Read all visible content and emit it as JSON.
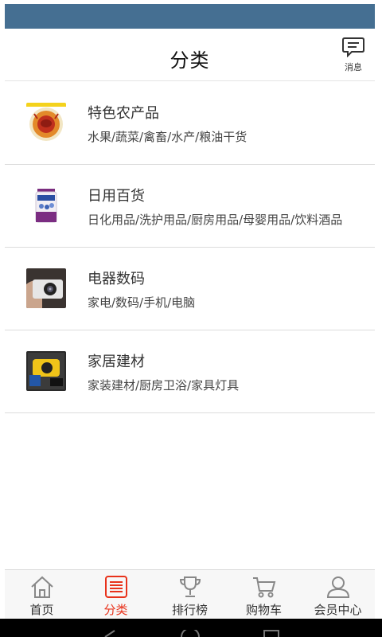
{
  "header": {
    "title": "分类",
    "messages_label": "消息"
  },
  "categories": [
    {
      "title": "特色农产品",
      "subtitle": "水果/蔬菜/禽畜/水产/粮油干货",
      "icon": "crab-dish-thumbnail"
    },
    {
      "title": "日用百货",
      "subtitle": "日化用品/洗护用品/厨房用品/母婴用品/饮料酒品",
      "icon": "milk-powder-thumbnail"
    },
    {
      "title": "电器数码",
      "subtitle": "家电/数码/手机/电脑",
      "icon": "action-camera-thumbnail"
    },
    {
      "title": "家居建材",
      "subtitle": "家装建材/厨房卫浴/家具灯具",
      "icon": "power-tool-thumbnail"
    }
  ],
  "tabs": [
    {
      "label": "首页",
      "icon": "home-icon"
    },
    {
      "label": "分类",
      "icon": "list-icon",
      "active": true
    },
    {
      "label": "排行榜",
      "icon": "trophy-icon"
    },
    {
      "label": "购物车",
      "icon": "cart-icon"
    },
    {
      "label": "会员中心",
      "icon": "user-icon"
    }
  ],
  "colors": {
    "status_bar": "#456f92",
    "accent": "#e8321b",
    "nav_bar": "#000000"
  }
}
